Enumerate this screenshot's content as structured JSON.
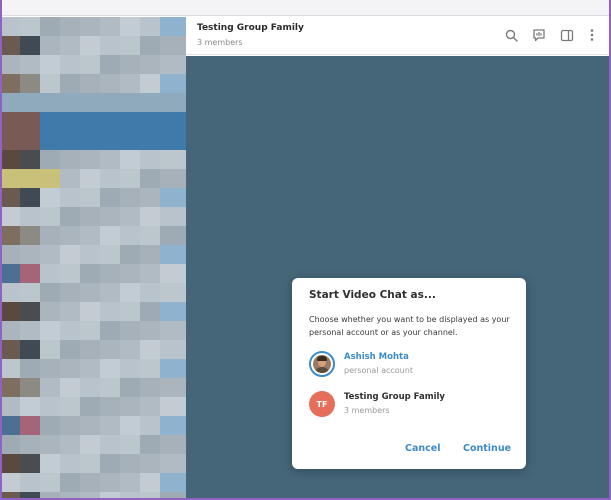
{
  "header": {
    "chat_title": "Testing Group Family",
    "chat_subtitle": "3 members",
    "icons": [
      "search-icon",
      "video-chat-icon",
      "sidebar-toggle-icon",
      "more-vertical-icon"
    ]
  },
  "dialog": {
    "title": "Start Video Chat as...",
    "description": "Choose whether you want to be displayed as your personal account or as your channel.",
    "options": [
      {
        "name": "Ashish Mohta",
        "subtitle": "personal account",
        "selected": true
      },
      {
        "name": "Testing Group Family",
        "subtitle": "3 members",
        "initials": "TF",
        "selected": false
      }
    ],
    "cancel_label": "Cancel",
    "continue_label": "Continue"
  },
  "colors": {
    "accent": "#3d8bc9",
    "chat_background": "#456579",
    "avatar_group": "#e56f5b"
  }
}
